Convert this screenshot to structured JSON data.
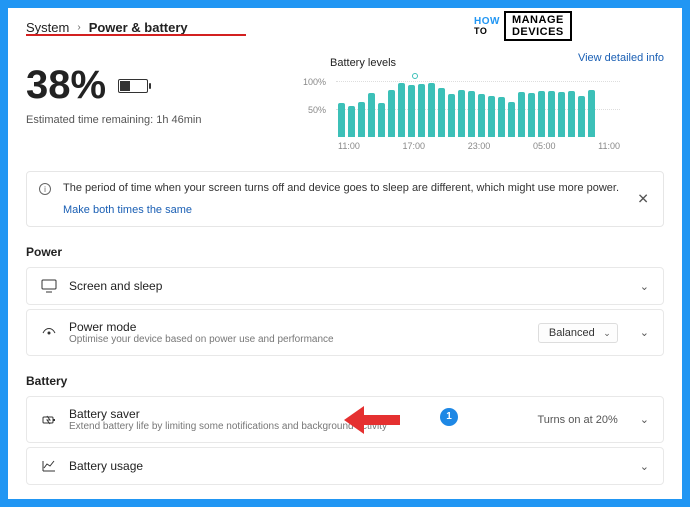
{
  "breadcrumb": {
    "parent": "System",
    "sep": "›",
    "current": "Power & battery"
  },
  "logo": {
    "how": "HOW",
    "to": "TO",
    "l1": "MANAGE",
    "l2": "DEVICES"
  },
  "detailed_link": "View detailed info",
  "status": {
    "percent": "38%",
    "estimated_label": "Estimated time remaining:",
    "estimated_value": "1h 46min"
  },
  "chart_data": {
    "type": "bar",
    "title": "Battery levels",
    "ylabel": "",
    "xlabel": "",
    "ylim": [
      0,
      100
    ],
    "yticks": [
      "100%",
      "50%"
    ],
    "categories": [
      "11:00",
      "17:00",
      "23:00",
      "05:00",
      "11:00"
    ],
    "values": [
      60,
      55,
      62,
      78,
      60,
      84,
      96,
      92,
      94,
      96,
      87,
      77,
      84,
      82,
      77,
      74,
      71,
      62,
      80,
      78,
      82,
      82,
      80,
      82,
      74,
      84
    ]
  },
  "info": {
    "text": "The period of time when your screen turns off and device goes to sleep are different, which might use more power.",
    "link": "Make both times the same"
  },
  "sections": {
    "power": {
      "label": "Power",
      "items": [
        {
          "id": "screen-sleep",
          "title": "Screen and sleep"
        },
        {
          "id": "power-mode",
          "title": "Power mode",
          "sub": "Optimise your device based on power use and performance",
          "select": "Balanced"
        }
      ]
    },
    "battery": {
      "label": "Battery",
      "items": [
        {
          "id": "battery-saver",
          "title": "Battery saver",
          "sub": "Extend battery life by limiting some notifications and background activity",
          "status": "Turns on at 20%"
        },
        {
          "id": "battery-usage",
          "title": "Battery usage"
        }
      ]
    }
  },
  "annotation": {
    "badge": "1"
  }
}
